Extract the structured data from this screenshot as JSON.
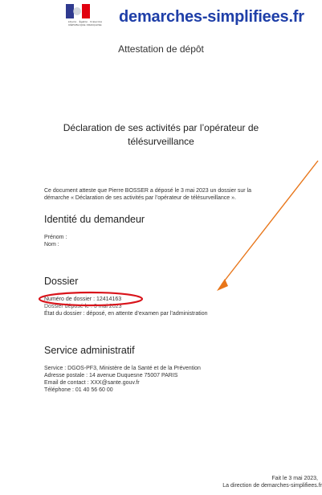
{
  "header": {
    "brand": "demarches-simplifiees.fr",
    "flag_motto": "Liberté · Égalité · Fraternité RÉPUBLIQUE FRANÇAISE",
    "subtitle": "Attestation de dépôt"
  },
  "document": {
    "title_line1": "Déclaration de ses activités par l’opérateur de",
    "title_line2": "télésurveillance",
    "intro_line1": "Ce document atteste que Pierre BOSSER a déposé le  3 mai 2023 un dossier sur la",
    "intro_line2": "démarche « Déclaration de ses activités par l’opérateur de télésurveillance ».",
    "identity": {
      "heading": "Identité du demandeur",
      "first_name_label": "Prénom :",
      "last_name_label": "Nom :"
    },
    "dossier": {
      "heading": "Dossier",
      "number": "Numéro de dossier : 12414163",
      "deposited": "Dossier déposé le : 3 mai 2023",
      "status": "État du dossier : déposé, en attente d’examen par l’administration"
    },
    "service": {
      "heading": "Service administratif",
      "service": "Service : DGOS-PF3, Ministère de la Santé et de la Prévention",
      "address": "Adresse postale : 14 avenue Duquesne 75007 PARIS",
      "email": "Email de contact : XXX@sante.gouv.fr",
      "phone": "Téléphone : 01 40 56 60 00"
    },
    "footer": {
      "date": "Fait le  3 mai 2023,",
      "signature": "La direction de demarches-simplifiees.fr"
    }
  },
  "annotations": {
    "arrow_color": "#e8761a",
    "ellipse_color": "#d9141b"
  }
}
